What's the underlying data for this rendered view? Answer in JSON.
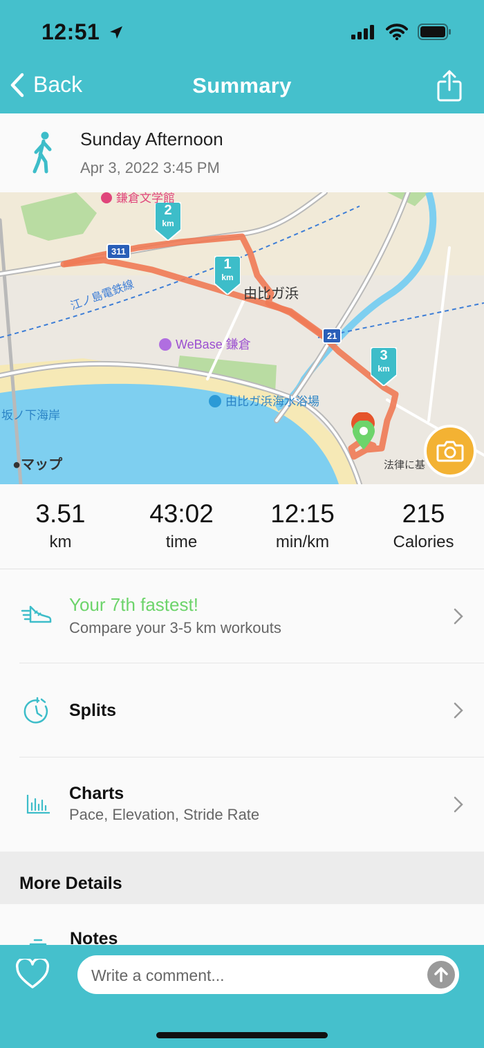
{
  "status_bar": {
    "time": "12:51"
  },
  "nav": {
    "back_label": "Back",
    "title": "Summary"
  },
  "activity": {
    "title": "Sunday Afternoon",
    "date": "Apr 3, 2022 3:45 PM",
    "icon": "walking-person-icon"
  },
  "map": {
    "labels": {
      "station_label": "由比ガ浜",
      "hotel": "WeBase 鎌倉",
      "beach": "由比ガ浜海水浴場",
      "coast": "坂ノ下海岸",
      "railway": "江ノ島電鉄線",
      "museum": "鎌倉文学館",
      "attribution": "マップ",
      "legal": "法律に基",
      "road_311": "311",
      "road_21": "21"
    },
    "markers": [
      "1 km",
      "2 km",
      "3 km"
    ],
    "marker_numbers": [
      "1",
      "2",
      "3"
    ],
    "marker_unit": "km",
    "colors": {
      "route": "#f07a55",
      "marker": "#3dbdc9",
      "start": "#6dd46b",
      "end": "#e5542b"
    }
  },
  "stats": [
    {
      "value": "3.51",
      "unit": "km"
    },
    {
      "value": "43:02",
      "unit": "time"
    },
    {
      "value": "12:15",
      "unit": "min/km"
    },
    {
      "value": "215",
      "unit": "Calories"
    }
  ],
  "rows": {
    "fastest": {
      "title": "Your 7th fastest!",
      "subtitle": "Compare your 3-5 km workouts"
    },
    "splits": {
      "title": "Splits"
    },
    "charts": {
      "title": "Charts",
      "subtitle": "Pace, Elevation, Stride Rate"
    }
  },
  "more_details": {
    "heading": "More Details",
    "notes_title": "Notes"
  },
  "comment": {
    "placeholder": "Write a comment..."
  },
  "theme": {
    "accent": "#45c0cc",
    "highlight_green": "#6dd46b"
  }
}
